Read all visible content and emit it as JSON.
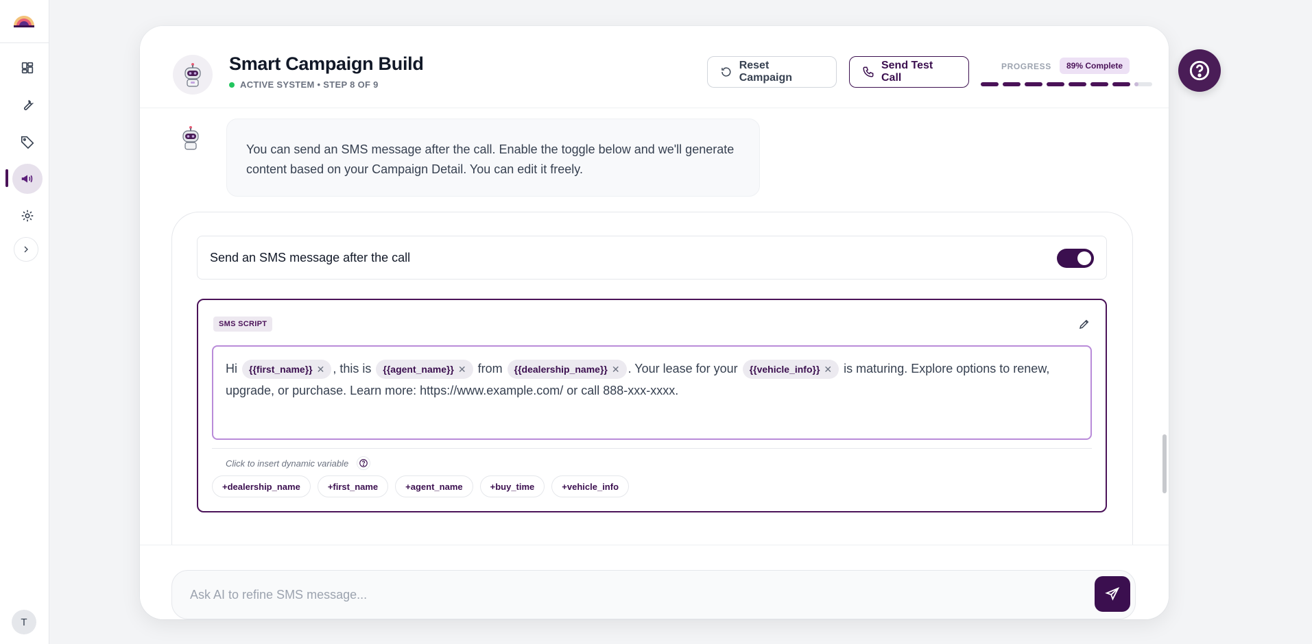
{
  "sidebar": {
    "items": [
      {
        "name": "dashboard-icon"
      },
      {
        "name": "tools-icon"
      },
      {
        "name": "tag-icon"
      },
      {
        "name": "megaphone-icon"
      },
      {
        "name": "gear-icon"
      }
    ],
    "active_index": 3,
    "avatar_initial": "T"
  },
  "header": {
    "title": "Smart Campaign Build",
    "subtitle": "ACTIVE SYSTEM • STEP 8 OF 9",
    "reset_label": "Reset Campaign",
    "test_call_label": "Send Test Call",
    "progress_label": "PROGRESS",
    "progress_badge": "89% Complete",
    "progress": {
      "completed_steps": 7,
      "partial_step": 8,
      "total_steps": 8
    }
  },
  "assistant_message": "You can send an SMS message after the call. Enable the toggle below and we'll generate content based on your Campaign Detail. You can edit it freely.",
  "sms": {
    "toggle_label": "Send an SMS message after the call",
    "toggle_on": true,
    "script_tag": "SMS SCRIPT",
    "script": {
      "t1": "Hi",
      "chip1": "{{first_name}}",
      "t2": ", this is",
      "chip2": "{{agent_name}}",
      "t3": "from",
      "chip3": "{{dealership_name}}",
      "t4": ". Your lease for your",
      "chip4": "{{vehicle_info}}",
      "t5": "is maturing. Explore options to renew, upgrade, or purchase. Learn more: https://www.example.com/ or call 888-xxx-xxxx."
    },
    "variables_hint": "Click to insert dynamic variable",
    "variables": [
      "+dealership_name",
      "+first_name",
      "+agent_name",
      "+buy_time",
      "+vehicle_info"
    ]
  },
  "footer": {
    "input_placeholder": "Ask AI to refine SMS message...",
    "input_value": ""
  },
  "colors": {
    "brand": "#3b0f4f",
    "brand_light": "#ede1f5",
    "status_active": "#22c55e"
  }
}
